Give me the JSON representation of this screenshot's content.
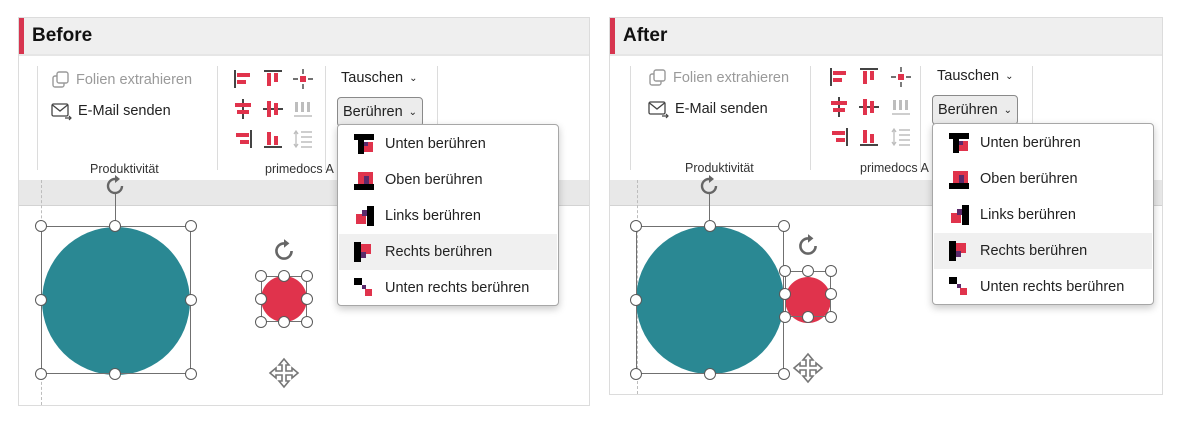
{
  "colors": {
    "accent": "#d7354f",
    "teal": "#2a8893",
    "red": "#e0334c",
    "purple": "#5b2a6b",
    "black": "#000000"
  },
  "before": {
    "title": "Before",
    "ribbon": {
      "extract_label": "Folien extrahieren",
      "email_label": "E-Mail senden",
      "group1_label": "Produktivität",
      "group2_label": "primedocs A",
      "swap_label": "Tauschen",
      "touch_label": "Berühren"
    },
    "menu": [
      {
        "label": "Unten berühren",
        "icon": "touch-bottom-icon"
      },
      {
        "label": "Oben berühren",
        "icon": "touch-top-icon"
      },
      {
        "label": "Links berühren",
        "icon": "touch-left-icon"
      },
      {
        "label": "Rechts berühren",
        "icon": "touch-right-icon",
        "highlighted": true
      },
      {
        "label": "Unten rechts berühren",
        "icon": "touch-bottom-right-icon"
      }
    ]
  },
  "after": {
    "title": "After",
    "ribbon": {
      "extract_label": "Folien extrahieren",
      "email_label": "E-Mail senden",
      "group1_label": "Produktivität",
      "group2_label": "primedocs A",
      "swap_label": "Tauschen",
      "touch_label": "Berühren"
    },
    "menu": [
      {
        "label": "Unten berühren",
        "icon": "touch-bottom-icon"
      },
      {
        "label": "Oben berühren",
        "icon": "touch-top-icon"
      },
      {
        "label": "Links berühren",
        "icon": "touch-left-icon"
      },
      {
        "label": "Rechts berühren",
        "icon": "touch-right-icon",
        "highlighted": true
      },
      {
        "label": "Unten rechts berühren",
        "icon": "touch-bottom-right-icon"
      }
    ]
  }
}
